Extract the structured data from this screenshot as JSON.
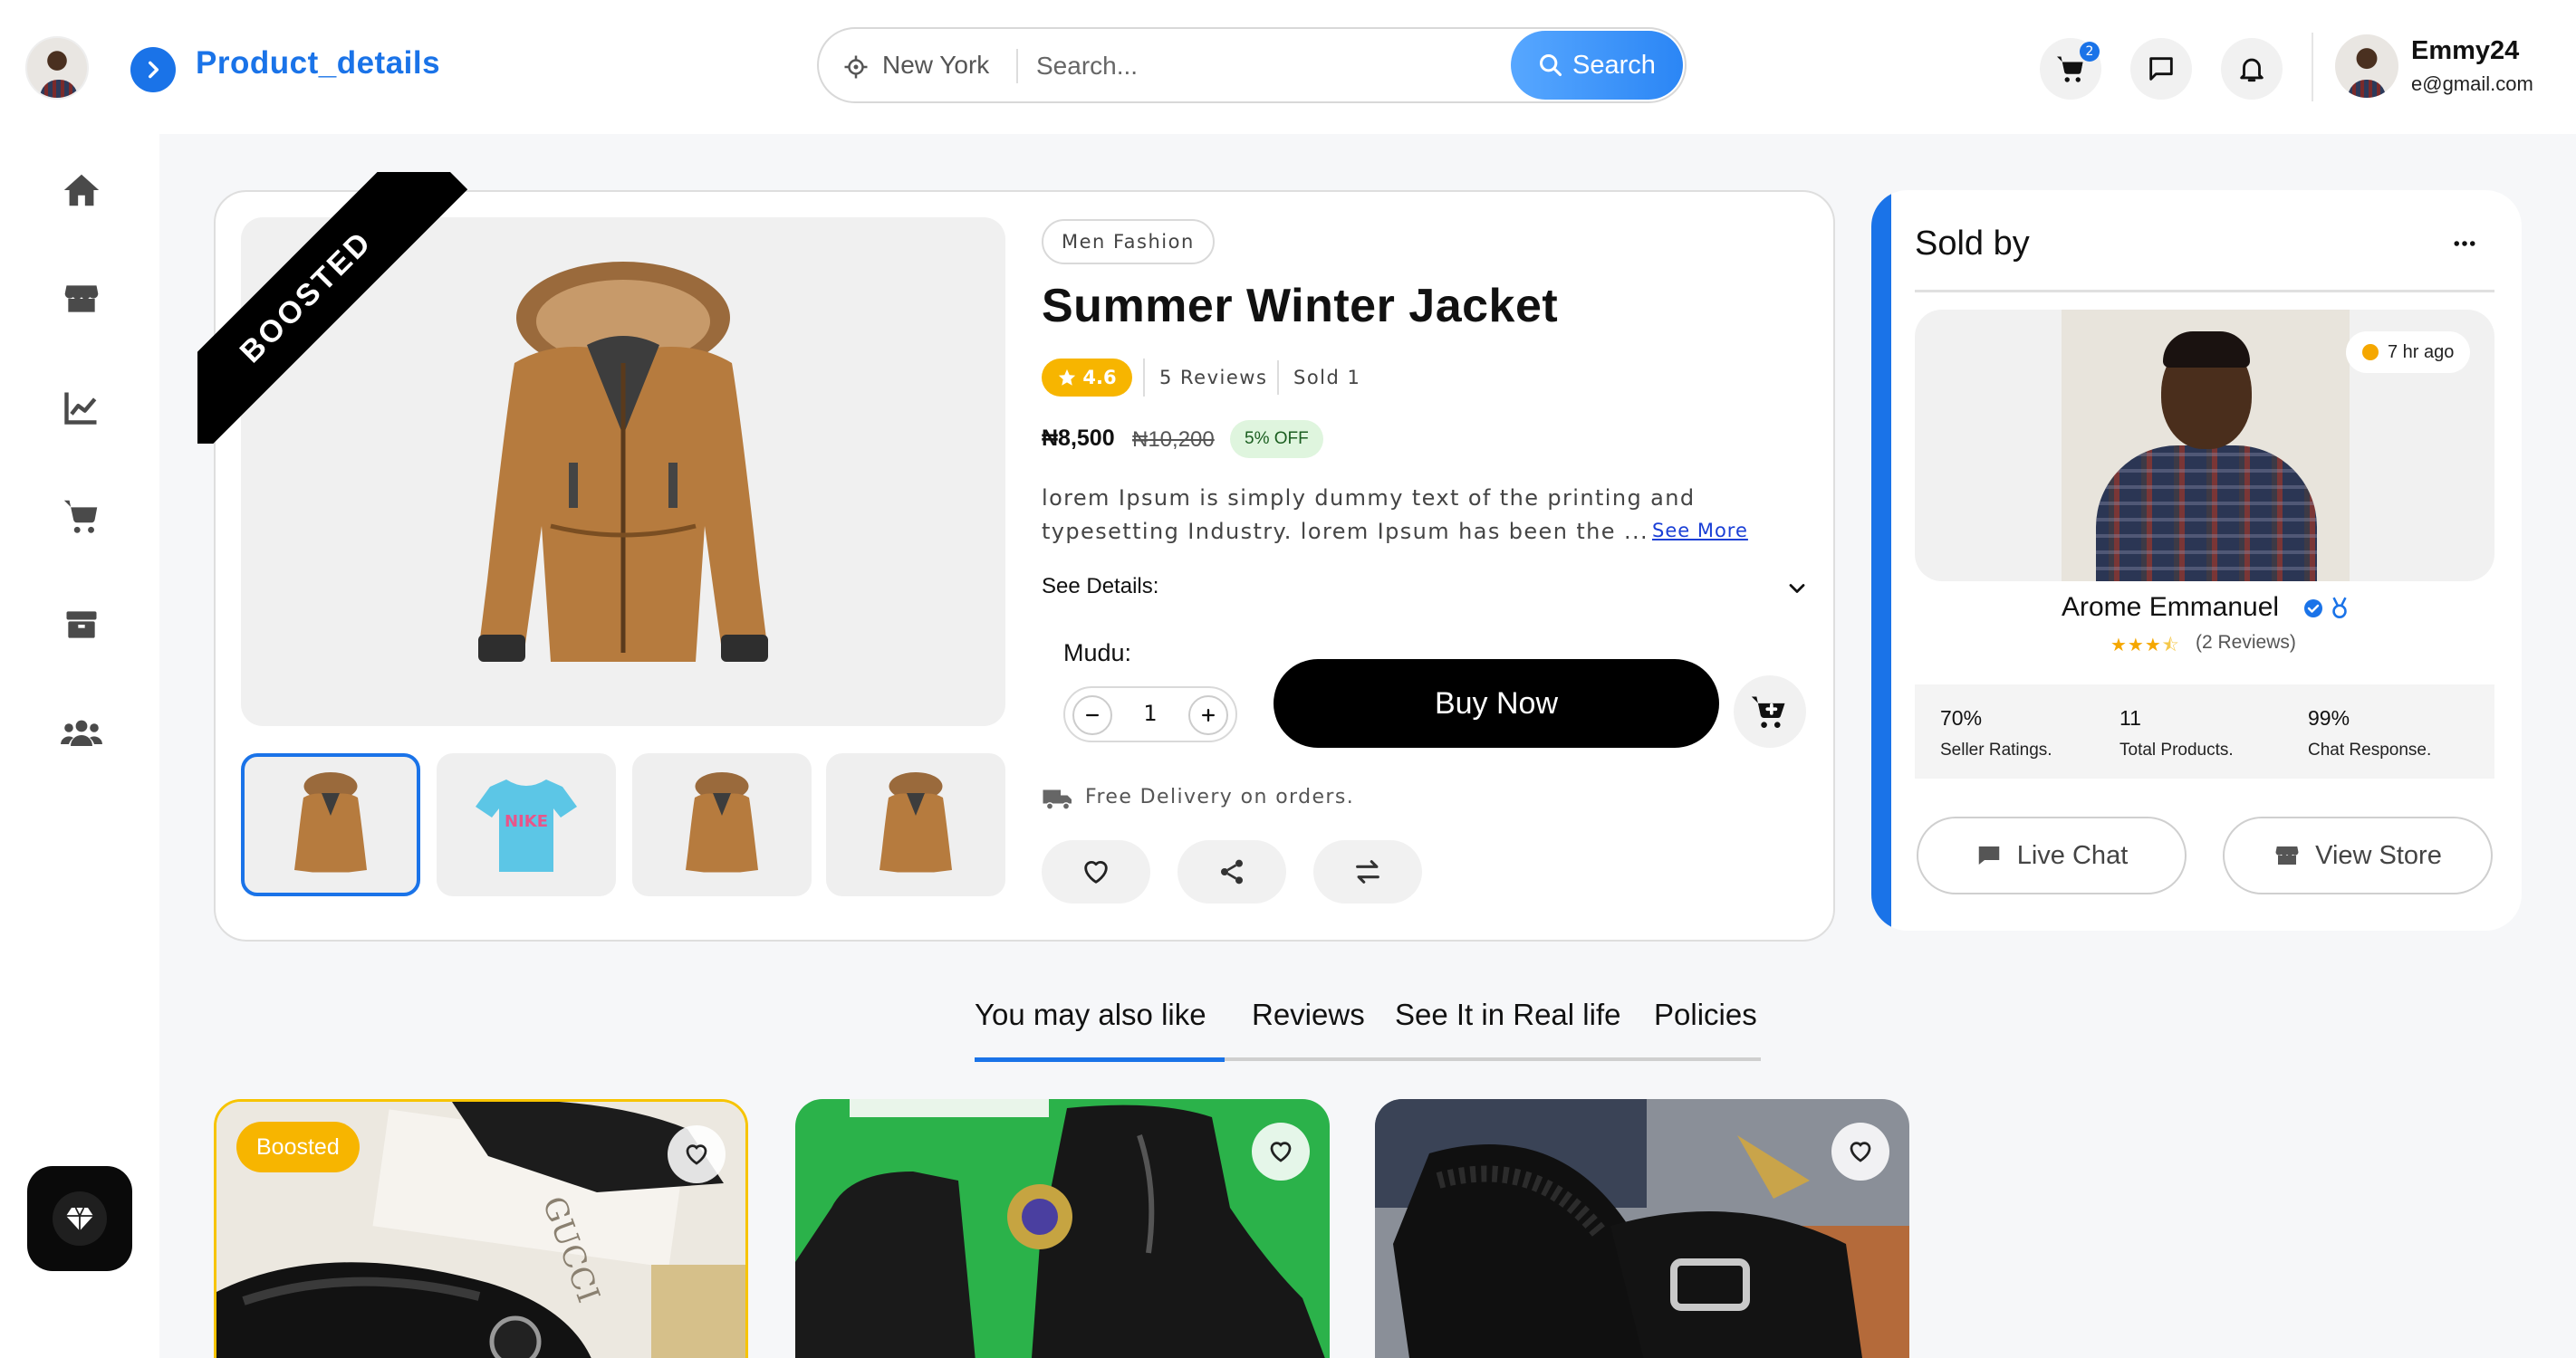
{
  "header": {
    "page_title": "Product_details",
    "search": {
      "location": "New York",
      "placeholder": "Search...",
      "button_label": "Search"
    },
    "cart_badge": "2",
    "user": {
      "name": "Emmy24",
      "email": "e@gmail.com"
    }
  },
  "sidebar": {
    "items": [
      {
        "icon": "home-icon"
      },
      {
        "icon": "store-icon"
      },
      {
        "icon": "analytics-icon"
      },
      {
        "icon": "cart-icon"
      },
      {
        "icon": "box-icon"
      },
      {
        "icon": "users-icon"
      }
    ],
    "premium_icon": "diamond-icon"
  },
  "product": {
    "ribbon": "BOOSTED",
    "category": "Men Fashion",
    "title": "Summer Winter Jacket",
    "rating": "4.6",
    "reviews": "5 Reviews",
    "sold": "Sold 1",
    "price": "₦8,500",
    "old_price": "₦10,200",
    "discount": "5% OFF",
    "description": "lorem Ipsum is simply dummy text of the printing and typesetting Industry. lorem Ipsum has been the ...",
    "see_more": "See More",
    "see_details": "See Details:",
    "quantity_label": "Mudu:",
    "quantity": "1",
    "buy_now": "Buy Now",
    "delivery": "Free Delivery on orders.",
    "thumbnails": [
      "jacket",
      "t-shirt",
      "jacket",
      "jacket"
    ]
  },
  "seller": {
    "heading": "Sold by",
    "last_seen": "7 hr ago",
    "name": "Arome Emmanuel",
    "rating_stars": 3.5,
    "reviews": "(2 Reviews)",
    "stats": [
      {
        "value": "70%",
        "label": "Seller Ratings."
      },
      {
        "value": "11",
        "label": "Total Products."
      },
      {
        "value": "99%",
        "label": "Chat Response."
      }
    ],
    "live_chat": "Live Chat",
    "view_store": "View Store"
  },
  "tabs": [
    "You may also like",
    "Reviews",
    "See It in Real life",
    "Policies"
  ],
  "active_tab": 0,
  "related": {
    "boosted_label": "Boosted",
    "items": [
      {
        "boosted": true
      },
      {
        "boosted": false
      },
      {
        "boosted": false
      }
    ]
  },
  "colors": {
    "accent": "#1a73e8",
    "rating": "#f7b500",
    "boosted": "#f7c400"
  }
}
